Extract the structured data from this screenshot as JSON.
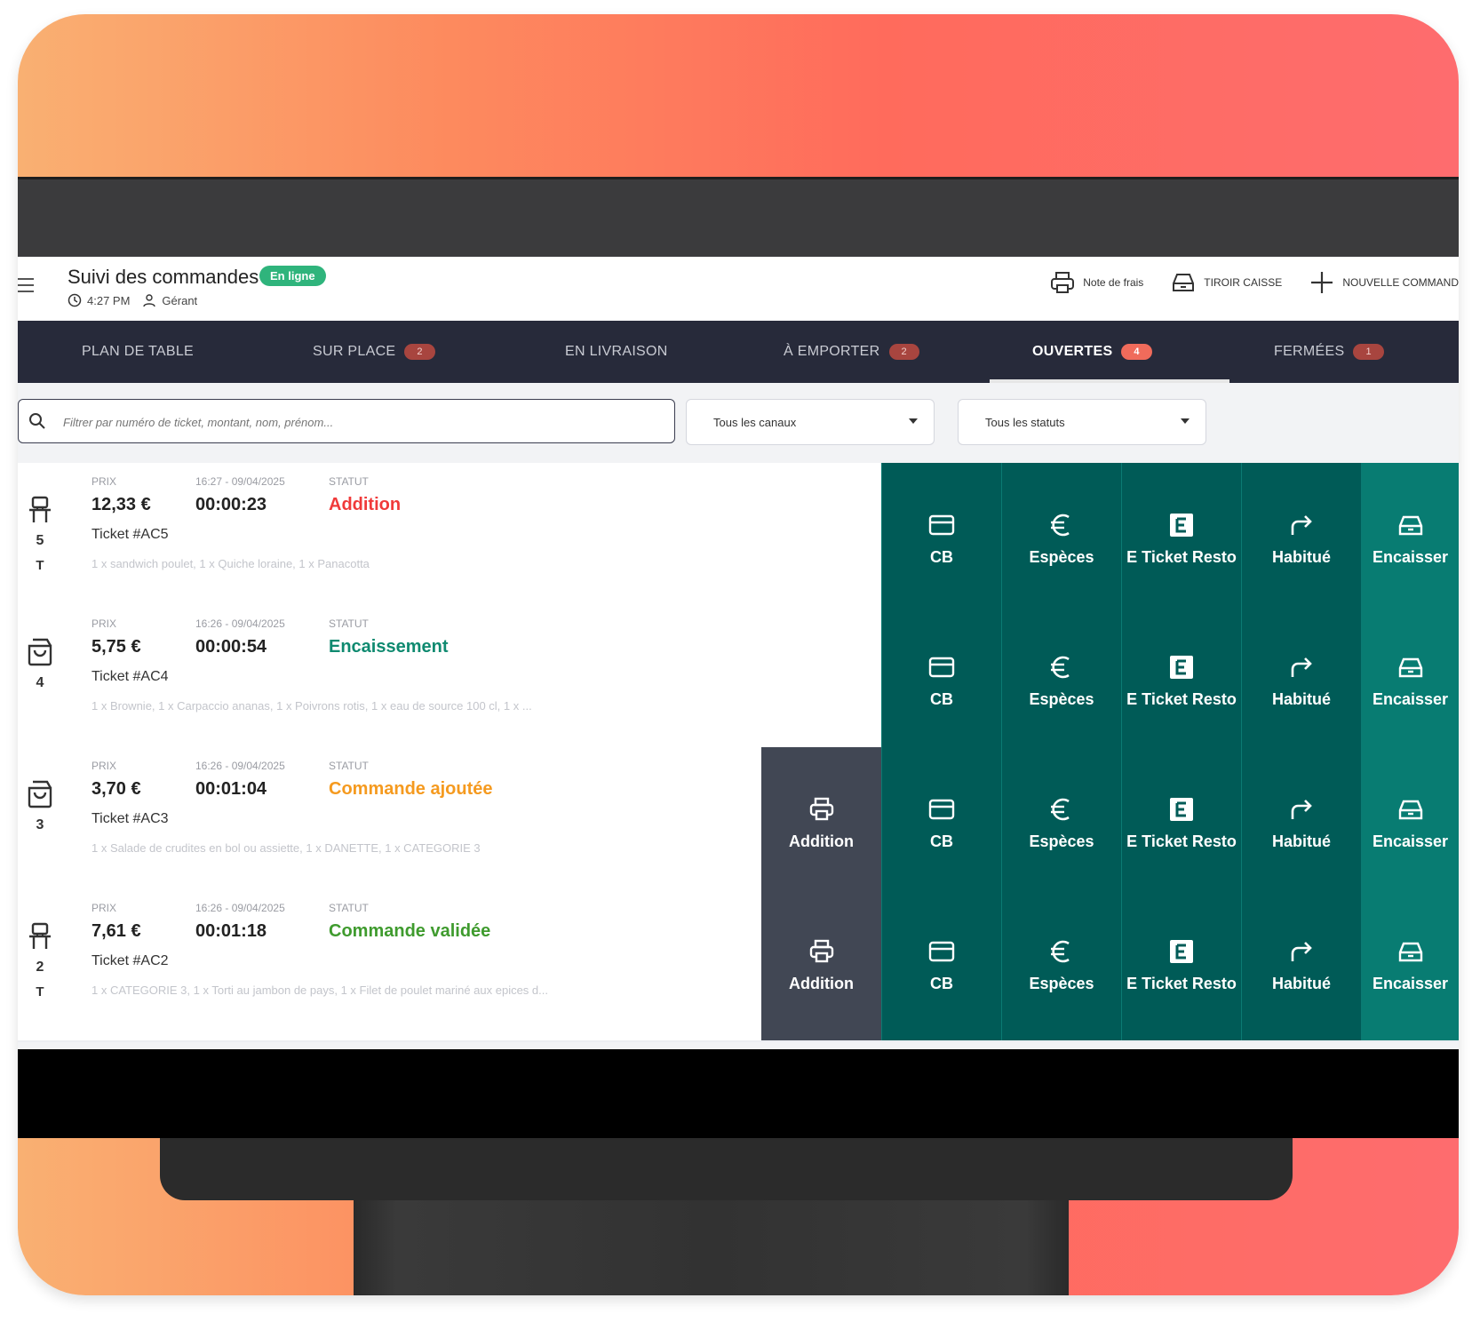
{
  "header": {
    "title": "Suivi des commandes",
    "badge": "En ligne",
    "time": "4:27 PM",
    "user": "Gérant",
    "actions": [
      {
        "label": "Note de frais",
        "icon": "printer-icon"
      },
      {
        "label": "TIROIR CAISSE",
        "icon": "cash-drawer-icon"
      },
      {
        "label": "NOUVELLE COMMAND",
        "icon": "plus-icon"
      }
    ]
  },
  "tabs": [
    {
      "label": "PLAN DE TABLE",
      "badge": "",
      "active": false
    },
    {
      "label": "SUR PLACE",
      "badge": "2",
      "active": false
    },
    {
      "label": "EN LIVRAISON",
      "badge": "",
      "active": false
    },
    {
      "label": "À EMPORTER",
      "badge": "2",
      "active": false
    },
    {
      "label": "OUVERTES",
      "badge": "4",
      "active": true
    },
    {
      "label": "FERMÉES",
      "badge": "1",
      "active": false
    }
  ],
  "filters": {
    "search_placeholder": "Filtrer par numéro de ticket, montant, nom, prénom...",
    "channel": "Tous les canaux",
    "status": "Tous les statuts"
  },
  "labels": {
    "price": "PRIX",
    "status": "STATUT"
  },
  "orders": [
    {
      "icon": "chair-icon",
      "number": "5",
      "sub": "T",
      "price": "12,33 €",
      "datetime": "16:27 - 09/04/2025",
      "duration": "00:00:23",
      "status": "Addition",
      "status_color": "#f03a3a",
      "ticket": "Ticket #AC5",
      "items": "1 x sandwich poulet, 1 x Quiche loraine, 1 x Panacotta",
      "addition_button": false
    },
    {
      "icon": "bag-icon",
      "number": "4",
      "sub": "",
      "price": "5,75 €",
      "datetime": "16:26 - 09/04/2025",
      "duration": "00:00:54",
      "status": "Encaissement",
      "status_color": "#0f8a70",
      "ticket": "Ticket #AC4",
      "items": "1 x Brownie, 1 x Carpaccio ananas, 1 x Poivrons rotis, 1 x eau de source 100 cl, 1 x ...",
      "addition_button": false
    },
    {
      "icon": "bag-icon",
      "number": "3",
      "sub": "",
      "price": "3,70 €",
      "datetime": "16:26 - 09/04/2025",
      "duration": "00:01:04",
      "status": "Commande ajoutée",
      "status_color": "#f59a1f",
      "ticket": "Ticket #AC3",
      "items": "1 x Salade de crudites en bol ou assiette, 1 x DANETTE, 1 x CATEGORIE 3",
      "addition_button": true
    },
    {
      "icon": "chair-icon",
      "number": "2",
      "sub": "T",
      "price": "7,61 €",
      "datetime": "16:26 - 09/04/2025",
      "duration": "00:01:18",
      "status": "Commande validée",
      "status_color": "#3f9b2e",
      "ticket": "Ticket #AC2",
      "items": "1 x CATEGORIE 3, 1 x Torti au jambon de pays, 1 x Filet de poulet mariné aux epices d...",
      "addition_button": true
    }
  ],
  "order_actions": [
    {
      "label": "CB",
      "icon": "card-icon"
    },
    {
      "label": "Espèces",
      "icon": "euro-icon"
    },
    {
      "label": "E Ticket Resto",
      "icon": "ticket-resto-icon"
    },
    {
      "label": "Habitué",
      "icon": "share-arrow-icon"
    },
    {
      "label": "Encaisser",
      "icon": "cash-drawer-icon"
    }
  ],
  "addition_label": "Addition"
}
